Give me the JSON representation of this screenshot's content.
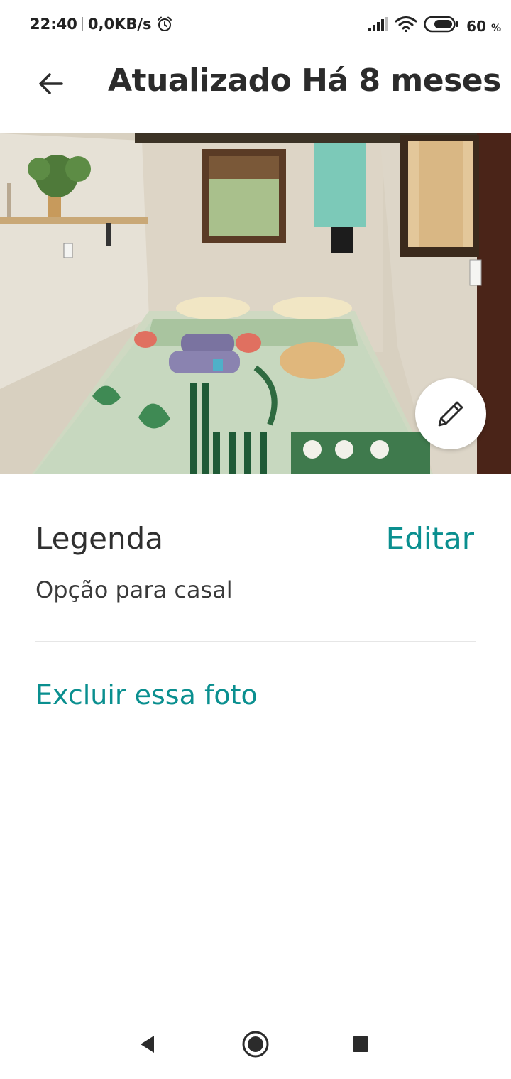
{
  "status_bar": {
    "time": "22:40",
    "network_speed": "0,0KB/s",
    "alarm_icon": "alarm-clock-icon",
    "signal_icon": "cell-signal-icon",
    "wifi_icon": "wifi-icon",
    "battery_icon": "battery-icon",
    "battery_percent": "60",
    "battery_unit": "%"
  },
  "toolbar": {
    "back_icon": "arrow-left-icon",
    "title": "Atualizado Há 8 meses"
  },
  "photo": {
    "edit_icon": "pencil-icon"
  },
  "caption": {
    "heading": "Legenda",
    "edit_label": "Editar",
    "value": "Opção para casal"
  },
  "actions": {
    "delete_label": "Excluir essa foto"
  },
  "nav_bar": {
    "back_icon": "triangle-back-icon",
    "home_icon": "circle-home-icon",
    "recents_icon": "square-recents-icon"
  },
  "colors": {
    "accent": "#0a8f8f",
    "text_primary": "#2f2f2f",
    "divider": "#e6e6e6"
  }
}
